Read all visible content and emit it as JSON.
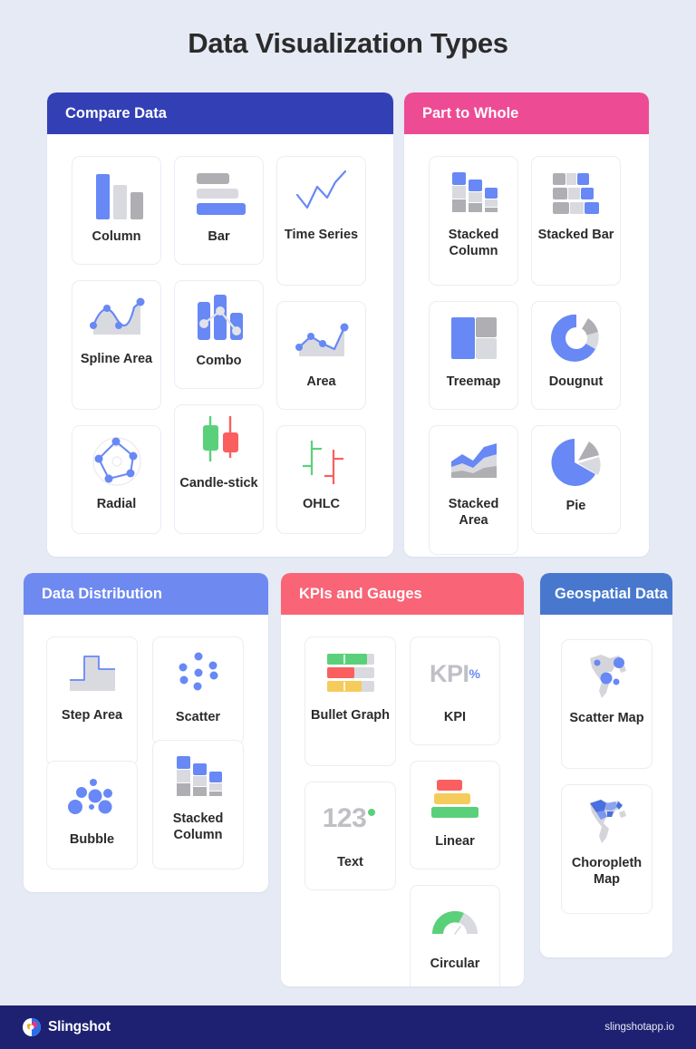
{
  "page": {
    "title": "Data Visualization Types",
    "background_color": "#E6EAF4",
    "title_color": "#2B2B2B"
  },
  "sections": [
    {
      "id": "compare-data",
      "title": "Compare Data",
      "header_color": "#3340B5",
      "tiles": [
        {
          "label": "Column",
          "icon": "column-chart-icon"
        },
        {
          "label": "Bar",
          "icon": "bar-chart-icon"
        },
        {
          "label": "Time Series",
          "icon": "time-series-chart-icon"
        },
        {
          "label": "Spline Area",
          "icon": "spline-area-chart-icon"
        },
        {
          "label": "Combo",
          "icon": "combo-chart-icon"
        },
        {
          "label": "Area",
          "icon": "area-chart-icon"
        },
        {
          "label": "Radial",
          "icon": "radial-chart-icon"
        },
        {
          "label": "Candle-stick",
          "icon": "candlestick-chart-icon"
        },
        {
          "label": "OHLC",
          "icon": "ohlc-chart-icon"
        }
      ]
    },
    {
      "id": "part-to-whole",
      "title": "Part to Whole",
      "header_color": "#EE4B95",
      "tiles": [
        {
          "label": "Stacked Column",
          "icon": "stacked-column-chart-icon"
        },
        {
          "label": "Stacked Bar",
          "icon": "stacked-bar-chart-icon"
        },
        {
          "label": "Treemap",
          "icon": "treemap-chart-icon"
        },
        {
          "label": "Dougnut",
          "icon": "doughnut-chart-icon"
        },
        {
          "label": "Stacked Area",
          "icon": "stacked-area-chart-icon"
        },
        {
          "label": "Pie",
          "icon": "pie-chart-icon"
        }
      ]
    },
    {
      "id": "data-distribution",
      "title": "Data Distribution",
      "header_color": "#6E8AF0",
      "tiles": [
        {
          "label": "Step Area",
          "icon": "step-area-chart-icon"
        },
        {
          "label": "Scatter",
          "icon": "scatter-chart-icon"
        },
        {
          "label": "Bubble",
          "icon": "bubble-chart-icon"
        },
        {
          "label": "Stacked Column",
          "icon": "stacked-column-chart-icon"
        }
      ]
    },
    {
      "id": "kpis-and-gauges",
      "title": "KPIs and Gauges",
      "header_color": "#F96476",
      "tiles": [
        {
          "label": "Bullet Graph",
          "icon": "bullet-graph-icon"
        },
        {
          "label": "KPI",
          "icon": "kpi-icon",
          "icon_text": "KPI",
          "icon_suffix": "%"
        },
        {
          "label": "Text",
          "icon": "text-number-icon",
          "icon_text": "123"
        },
        {
          "label": "Linear",
          "icon": "linear-gauge-icon"
        },
        {
          "label": "Circular",
          "icon": "circular-gauge-icon"
        }
      ]
    },
    {
      "id": "geospatial-data",
      "title": "Geospatial Data",
      "header_color": "#4878CE",
      "tiles": [
        {
          "label": "Scatter Map",
          "icon": "scatter-map-icon"
        },
        {
          "label": "Choropleth Map",
          "icon": "choropleth-map-icon"
        }
      ]
    }
  ],
  "footer": {
    "brand": "Slingshot",
    "url": "slingshotapp.io",
    "background_color": "#1E2171"
  },
  "palette": {
    "blue": "#6788F5",
    "grey_light": "#D9DADF",
    "grey_mid": "#AEAEB3",
    "green": "#5BD07A",
    "red": "#FA5F5F",
    "yellow": "#F5CB5C",
    "map_grey": "#D4D5DA"
  }
}
